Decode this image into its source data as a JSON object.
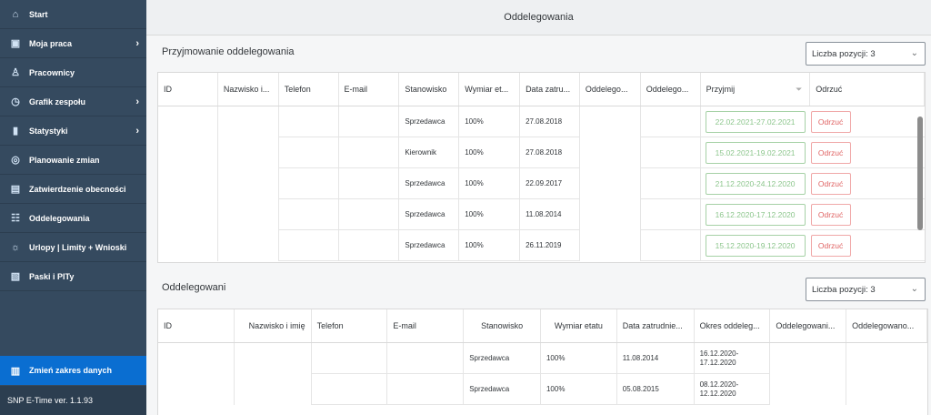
{
  "sidebar": {
    "items": [
      {
        "label": "Start",
        "icon": "home-icon"
      },
      {
        "label": "Moja praca",
        "icon": "briefcase-icon"
      },
      {
        "label": "Pracownicy",
        "icon": "employees-icon"
      },
      {
        "label": "Grafik zespołu",
        "icon": "schedule-icon"
      },
      {
        "label": "Statystyki",
        "icon": "bar-chart-icon"
      },
      {
        "label": "Planowanie zmian",
        "icon": "planning-icon"
      },
      {
        "label": "Zatwierdzenie obecności",
        "icon": "document-icon"
      },
      {
        "label": "Oddelegowania",
        "icon": "group-icon"
      },
      {
        "label": "Urlopy | Limity + Wnioski",
        "icon": "vacation-icon"
      },
      {
        "label": "Paski i PITy",
        "icon": "payslip-icon"
      }
    ],
    "active_label": "Zmień zakres danych",
    "version": "SNP E-Time ver. 1.1.93"
  },
  "page": {
    "title": "Oddelegowania"
  },
  "section1": {
    "title": "Przyjmowanie oddelegowania",
    "select_label": "Liczba pozycji: 3",
    "headers": [
      "ID",
      "Nazwisko i...",
      "Telefon",
      "E-mail",
      "Stanowisko",
      "Wymiar et...",
      "Data zatru...",
      "Oddelego...",
      "Oddelego...",
      "Przyjmij",
      "Odrzuć"
    ],
    "rows": [
      {
        "stanowisko": "Sprzedawca",
        "wymiar": "100%",
        "data": "27.08.2018",
        "accept": "22.02.2021-27.02.2021",
        "reject": "Odrzuć"
      },
      {
        "stanowisko": "Kierownik",
        "wymiar": "100%",
        "data": "27.08.2018",
        "accept": "15.02.2021-19.02.2021",
        "reject": "Odrzuć"
      },
      {
        "stanowisko": "Sprzedawca",
        "wymiar": "100%",
        "data": "22.09.2017",
        "accept": "21.12.2020-24.12.2020",
        "reject": "Odrzuć"
      },
      {
        "stanowisko": "Sprzedawca",
        "wymiar": "100%",
        "data": "11.08.2014",
        "accept": "16.12.2020-17.12.2020",
        "reject": "Odrzuć"
      },
      {
        "stanowisko": "Sprzedawca",
        "wymiar": "100%",
        "data": "26.11.2019",
        "accept": "15.12.2020-19.12.2020",
        "reject": "Odrzuć"
      }
    ]
  },
  "section2": {
    "title": "Oddelegowani",
    "select_label": "Liczba pozycji: 3",
    "headers": [
      "ID",
      "Nazwisko i imię",
      "Telefon",
      "E-mail",
      "Stanowisko",
      "Wymiar etatu",
      "Data zatrudnie...",
      "Okres oddeleg...",
      "Oddelegowani...",
      "Oddelegowano..."
    ],
    "rows": [
      {
        "stanowisko": "Sprzedawca",
        "wymiar": "100%",
        "data": "11.08.2014",
        "okres": "16.12.2020-\n17.12.2020"
      },
      {
        "stanowisko": "Sprzedawca",
        "wymiar": "100%",
        "data": "05.08.2015",
        "okres": "08.12.2020-\n12.12.2020"
      }
    ]
  }
}
